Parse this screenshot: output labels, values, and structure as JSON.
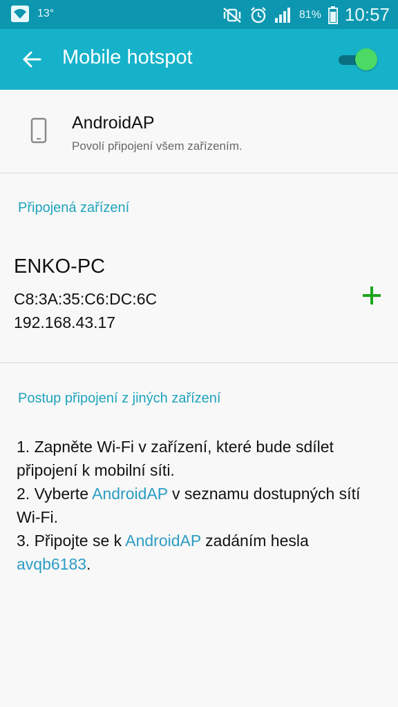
{
  "status_bar": {
    "temperature": "13°",
    "battery_percent": "81%",
    "time": "10:57"
  },
  "app_bar": {
    "title": "Mobile hotspot",
    "hotspot_enabled": true
  },
  "network": {
    "name": "AndroidAP",
    "subtitle": "Povolí připojení všem zařízením."
  },
  "connected_section": {
    "header": "Připojená zařízení",
    "devices": [
      {
        "name": "ENKO-PC",
        "mac": "C8:3A:35:C6:DC:6C",
        "ip": "192.168.43.17"
      }
    ]
  },
  "instructions_section": {
    "header": "Postup připojení z jiných zařízení",
    "step1": "1. Zapněte Wi-Fi v zařízení, které bude sdílet připojení k mobilní síti.",
    "step2_pre": "2. Vyberte ",
    "step2_link": "AndroidAP",
    "step2_post": " v seznamu dostupných sítí Wi-Fi.",
    "step3_pre": "3. Připojte se k ",
    "step3_link": "AndroidAP",
    "step3_mid": " zadáním hesla ",
    "step3_password": "avqb6183",
    "step3_post": "."
  },
  "colors": {
    "status_bar": "#0c96af",
    "app_bar": "#15b2ca",
    "accent": "#1ea3bd",
    "switch_on": "#4cd964",
    "add_icon": "#1aa51a"
  },
  "icons": [
    "wifi-icon",
    "mute-vibrate-icon",
    "alarm-icon",
    "signal-icon",
    "battery-icon",
    "back-arrow-icon",
    "phone-icon",
    "plus-icon"
  ]
}
